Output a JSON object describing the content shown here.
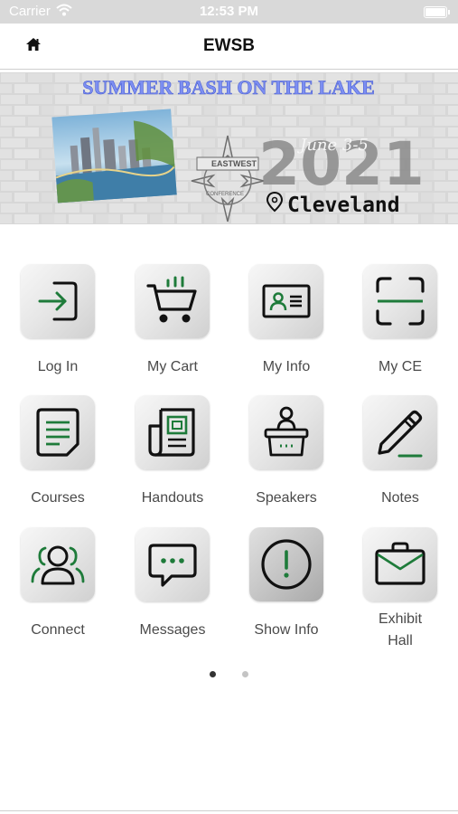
{
  "status_bar": {
    "carrier": "Carrier",
    "time": "12:53 PM"
  },
  "nav": {
    "title": "EWSB",
    "home_icon": "home-icon"
  },
  "banner": {
    "headline": "SUMMER BASH ON THE LAKE",
    "logo_top": "EAST",
    "logo_mid": "WEST",
    "logo_bottom": "CONFERENCE",
    "date": "June 3-5",
    "year": "2021",
    "city": "Cleveland"
  },
  "colors": {
    "accent": "#1e7b3a",
    "icon_stroke": "#111111",
    "label": "#4a4a4a",
    "dot_active": "#333333",
    "dot_inactive": "#c4c4c4"
  },
  "tiles": [
    {
      "label": "Log In",
      "icon": "login-icon"
    },
    {
      "label": "My Cart",
      "icon": "cart-icon"
    },
    {
      "label": "My Info",
      "icon": "id-card-icon"
    },
    {
      "label": "My CE",
      "icon": "scan-icon"
    },
    {
      "label": "Courses",
      "icon": "document-icon"
    },
    {
      "label": "Handouts",
      "icon": "newspaper-icon"
    },
    {
      "label": "Speakers",
      "icon": "podium-speaker-icon"
    },
    {
      "label": "Notes",
      "icon": "pencil-icon"
    },
    {
      "label": "Connect",
      "icon": "people-icon"
    },
    {
      "label": "Messages",
      "icon": "chat-bubble-icon"
    },
    {
      "label": "Show Info",
      "icon": "info-exclamation-icon"
    },
    {
      "label": "Exhibit Hall",
      "icon": "briefcase-icon"
    }
  ],
  "pager": {
    "pages": 2,
    "current": 1
  }
}
